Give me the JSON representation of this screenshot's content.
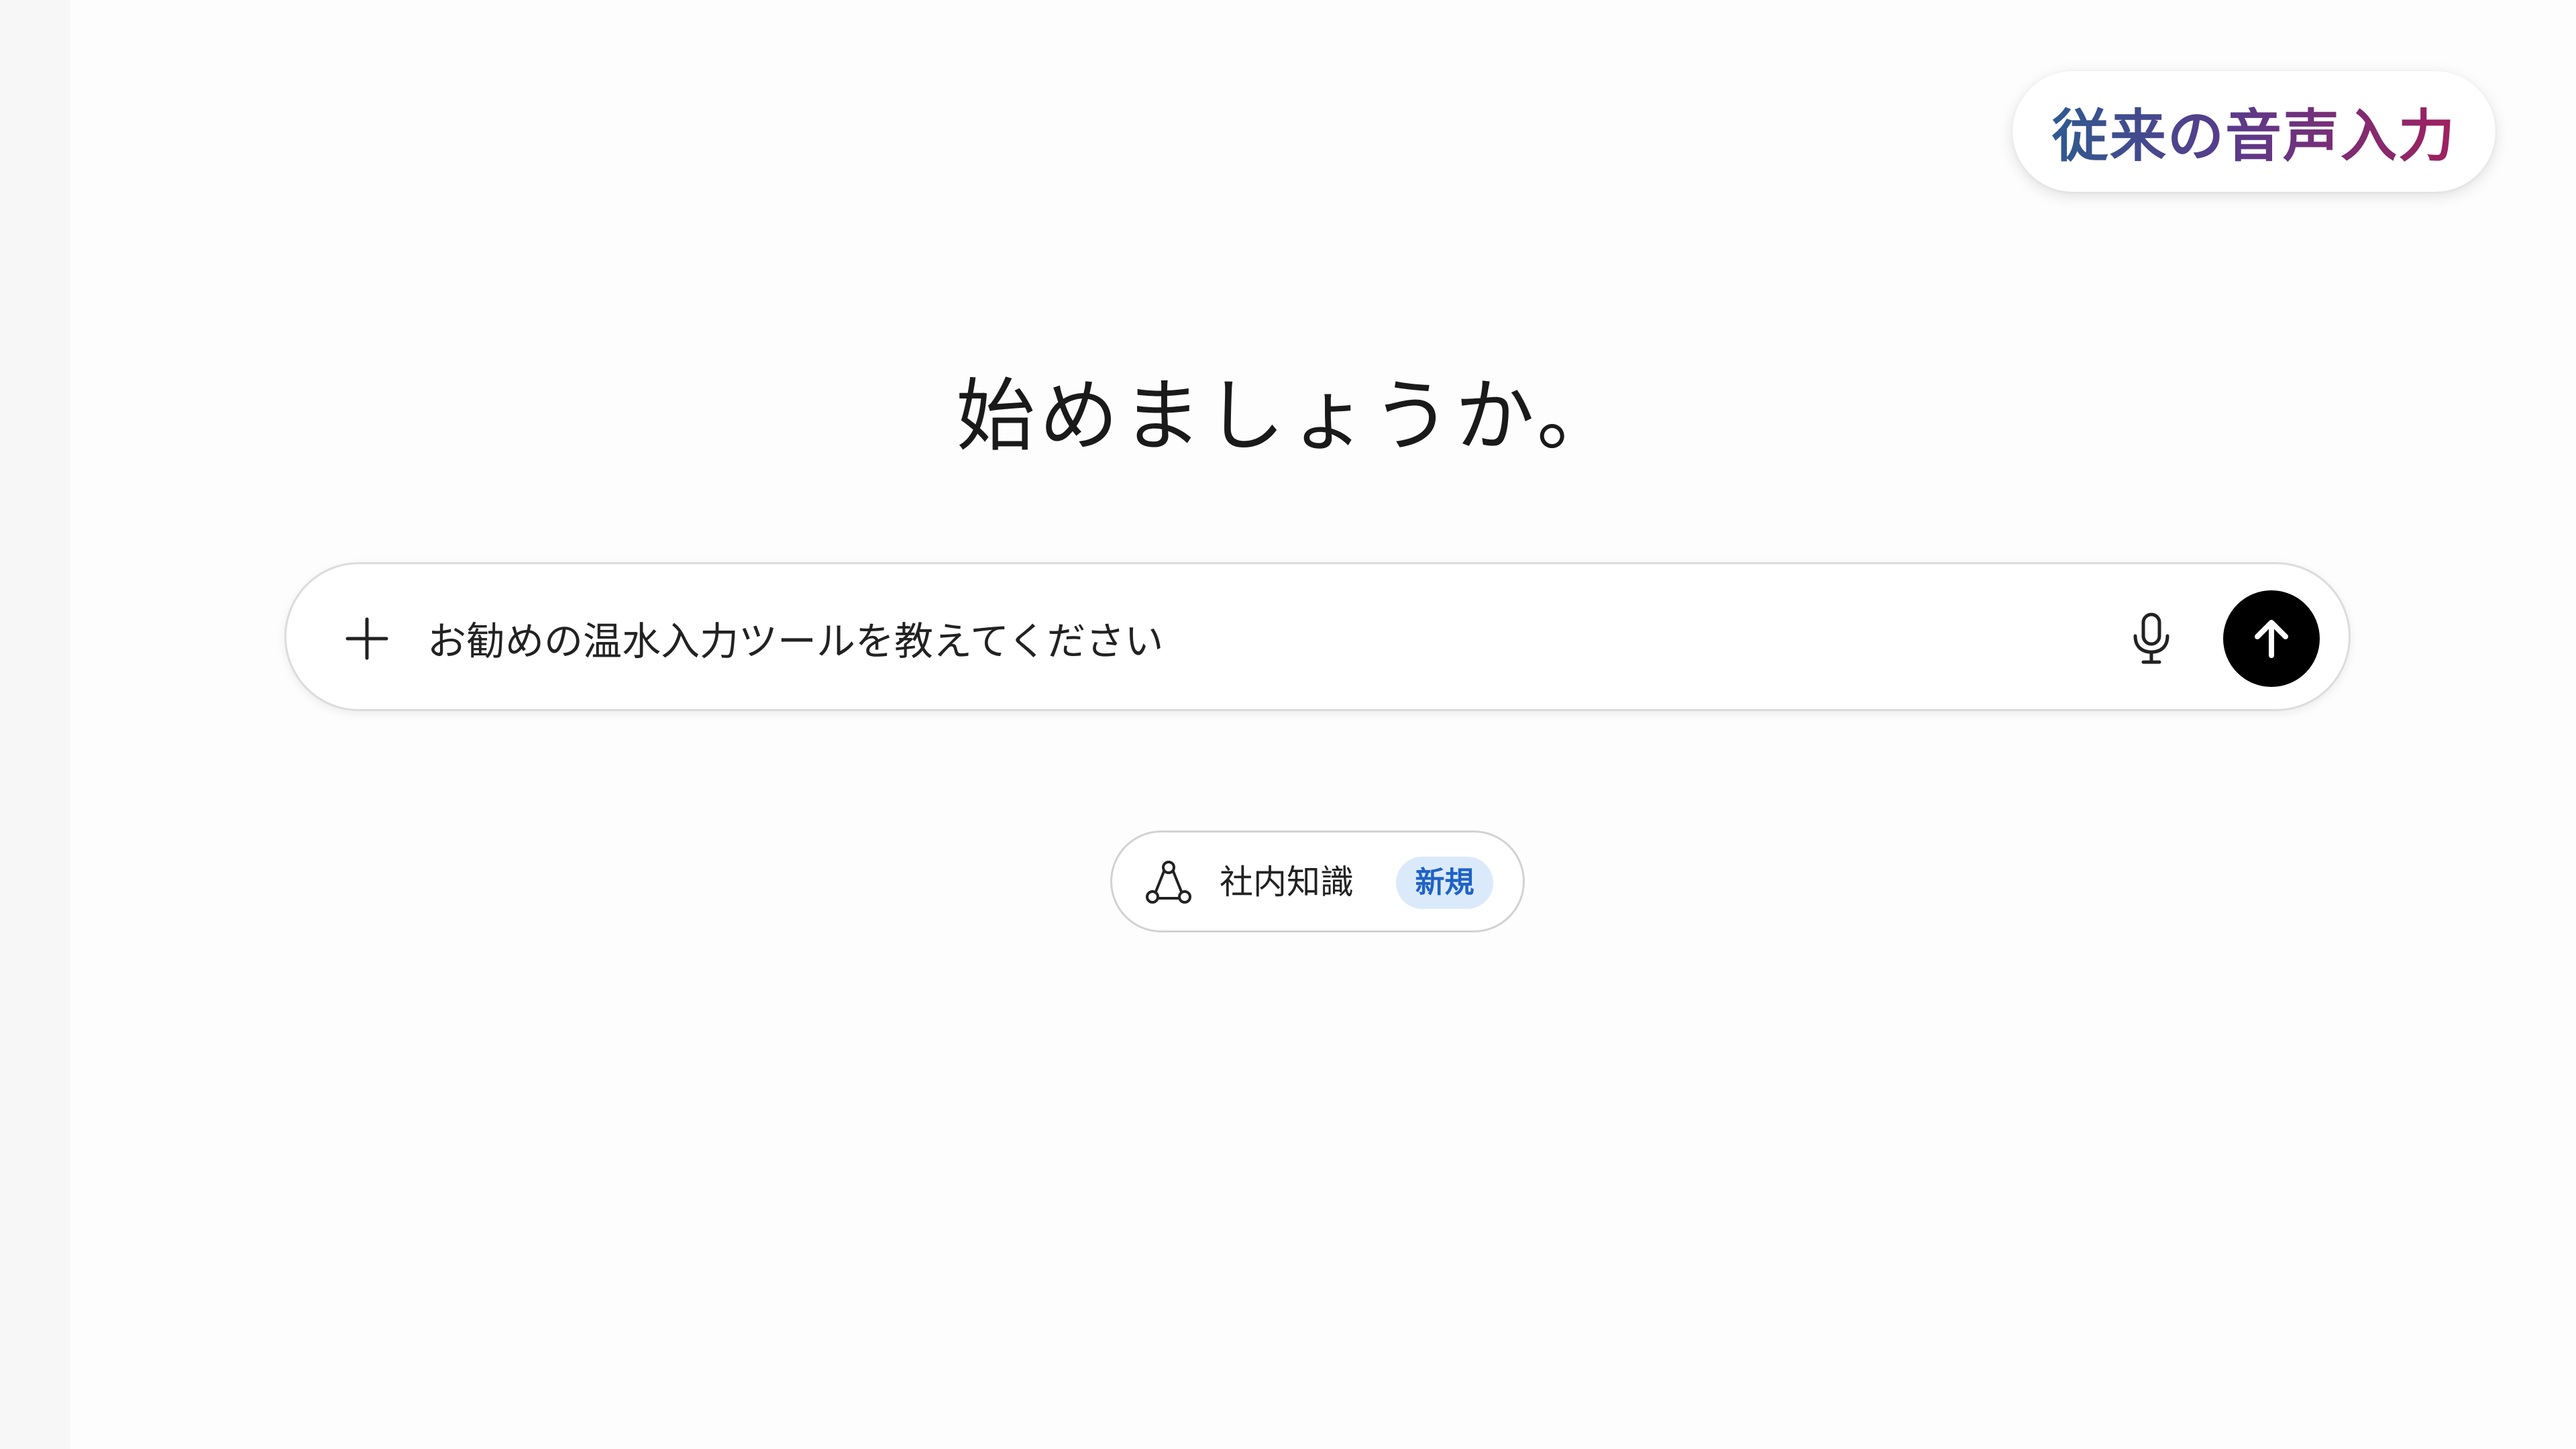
{
  "badge": {
    "label": "従来の音声入力"
  },
  "main": {
    "heading": "始めましょうか。"
  },
  "composer": {
    "input_value": "お勧めの温水入力ツールを教えてください",
    "plus_icon": "plus-icon",
    "mic_icon": "microphone-icon",
    "send_icon": "arrow-up-icon"
  },
  "chip": {
    "label": "社内知識",
    "tag": "新規",
    "icon": "knowledge-network-icon"
  },
  "colors": {
    "badge_gradient_start": "#2f5a90",
    "badge_gradient_end": "#a0205e",
    "send_button": "#000000",
    "tag_background": "#dbeafb",
    "tag_text": "#1f62c6"
  }
}
